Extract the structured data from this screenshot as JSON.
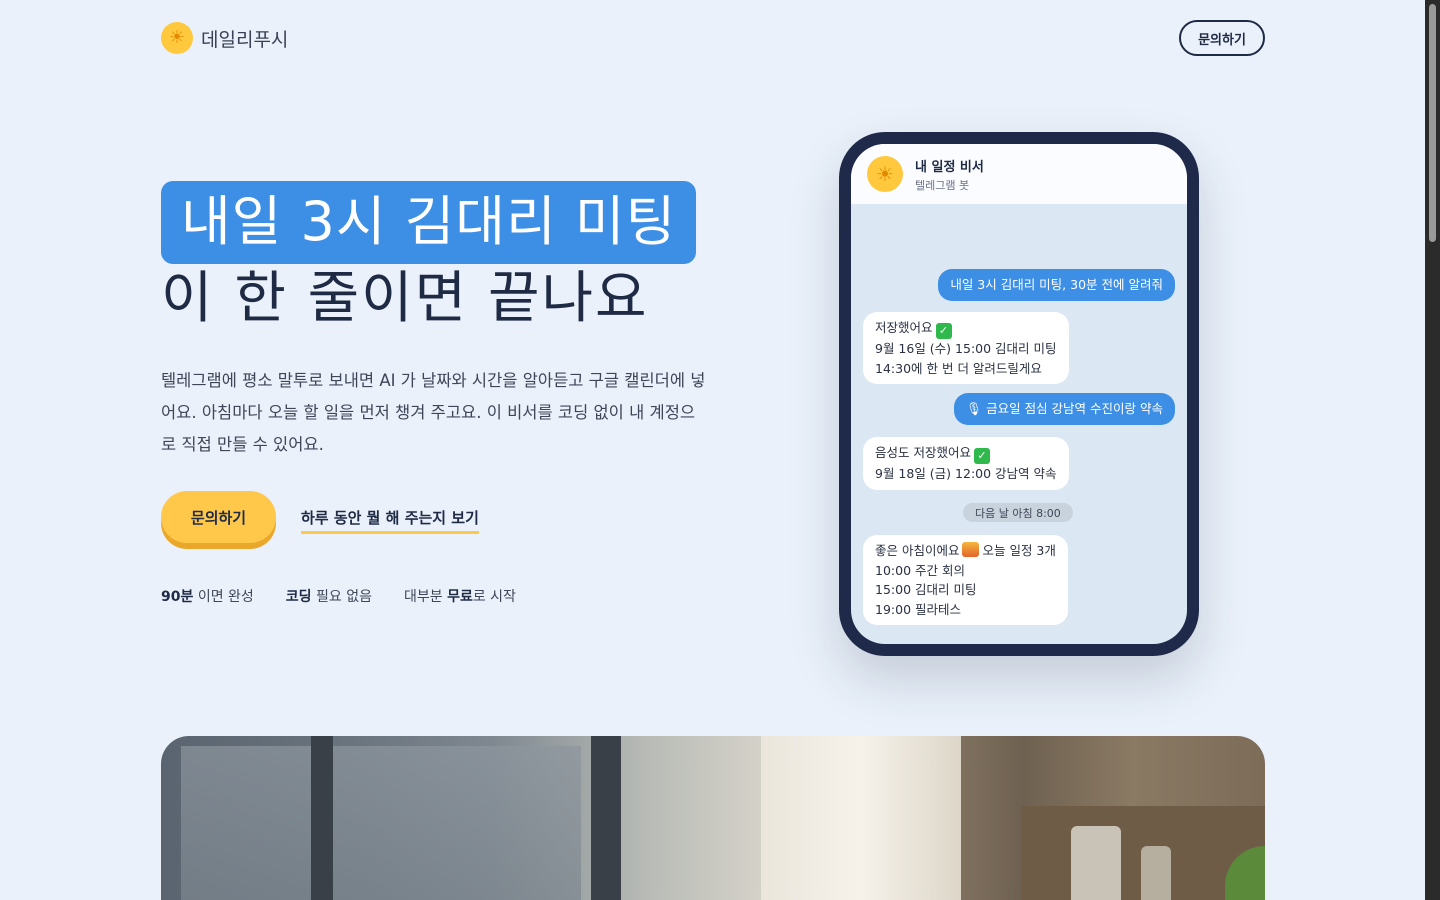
{
  "header": {
    "brand": "데일리푸시",
    "logo_icon": "sun-icon",
    "contact_label": "문의하기"
  },
  "hero": {
    "headline_highlight": "내일 3시 김대리 미팅",
    "headline_rest": "이 한 줄이면 끝나요",
    "description": "텔레그램에 평소 말투로 보내면 AI 가 날짜와 시간을 알아듣고 구글 캘린더에 넣어요. 아침마다 오늘 할 일을 먼저 챙겨 주고요. 이 비서를 코딩 없이 내 계정으로 직접 만들 수 있어요.",
    "primary_cta": "문의하기",
    "secondary_cta": "하루 동안 뭘 해 주는지 보기",
    "features": [
      {
        "strong": "90분",
        "rest": " 이면 완성"
      },
      {
        "strong": "코딩",
        "rest": " 필요 없음"
      },
      {
        "prefix": "대부분 ",
        "strong": "무료",
        "rest": "로 시작"
      }
    ]
  },
  "phone": {
    "bot_name": "내 일정 비서",
    "bot_sub": "텔레그램 봇",
    "messages": [
      {
        "dir": "out",
        "lines": [
          "내일 3시 김대리 미팅, 30분 전에 알려줘"
        ]
      },
      {
        "dir": "in",
        "lines": [
          "저장했어요",
          "9월 16일 (수) 15:00 김대리 미팅",
          "14:30에 한 번 더 알려드릴게요"
        ]
      },
      {
        "dir": "out",
        "icon": "microphone-icon",
        "lines": [
          "금요일 점심 강남역 수진이랑 약속"
        ]
      },
      {
        "dir": "in",
        "lines": [
          "음성도 저장했어요",
          "9월 18일 (금) 12:00 강남역 약속"
        ]
      },
      {
        "dir": "in",
        "lines": [
          "좋은 아침이에요",
          "오늘 일정 3개",
          "10:00 주간 회의",
          "15:00 김대리 미팅",
          "19:00 필라테스"
        ]
      }
    ],
    "date_divider": "다음 날 아침 8:00"
  },
  "colors": {
    "background": "#eaf1fa",
    "accent_blue": "#3d8fe6",
    "accent_yellow": "#ffc84a",
    "navy": "#1f2a44"
  }
}
